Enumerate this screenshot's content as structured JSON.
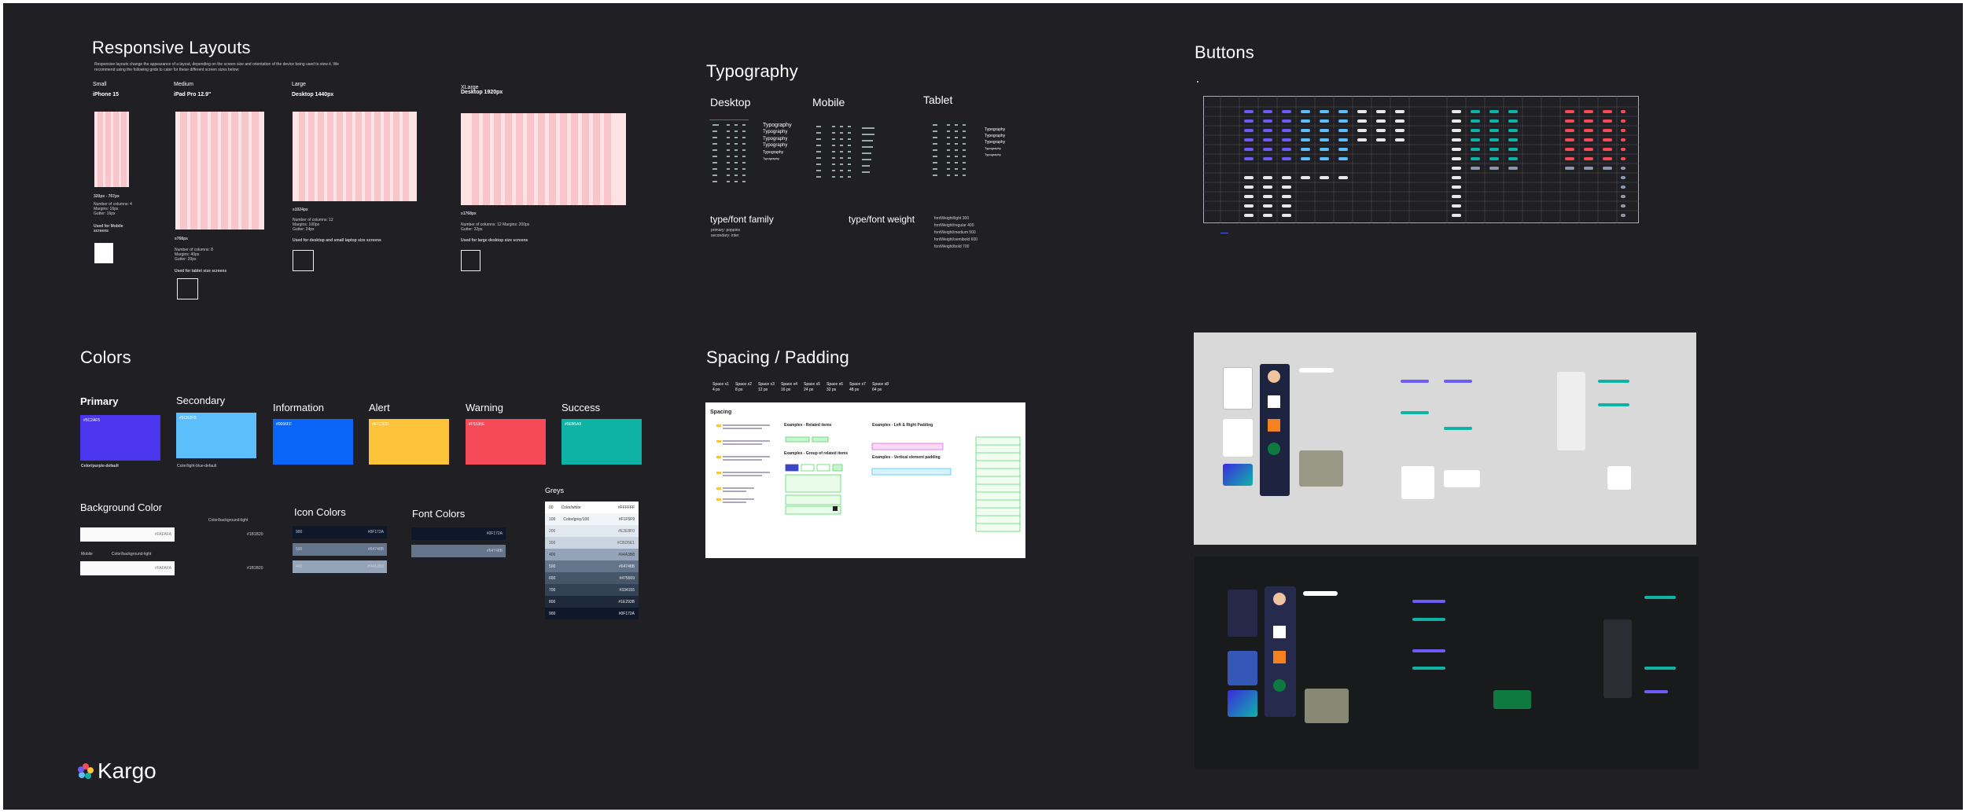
{
  "layouts": {
    "title": "Responsive Layouts",
    "desc1": "Responsive layouts change the appearance of a layout, depending on the screen size and orientation of the device being used to view it. We",
    "desc2": "recommend using the following grids to cater for these different screen sizes below:",
    "small": {
      "size": "Small",
      "device": "iPhone 15",
      "range": "320px - 767px",
      "info1": "Number of columns: 4",
      "info2": "Margins: 16px",
      "info3": "Gutter: 16px",
      "use": "Used for Mobile screens"
    },
    "medium": {
      "size": "Medium",
      "device": "iPad Pro 12.9\"",
      "range": "≥768px",
      "info1": "Number of columns: 8",
      "info2": "Margins: 40px",
      "info3": "Gutter: 20px",
      "use": "Used for tablet size screens"
    },
    "large": {
      "size": "Large",
      "device": "Desktop 1440px",
      "range": "≥1024px",
      "info1": "Number of columns: 12",
      "info2": "Margins: 100px",
      "info3": "Gutter: 24px",
      "use": "Used for desktop and small laptop size screens"
    },
    "xlarge": {
      "size": "XLarge",
      "device": "Desktop 1920px",
      "range": "≥1768px",
      "info1": "Number of columns: 12 Margins: 200px",
      "info2": "Gutter: 32px",
      "use": "Used for large desktop size screens"
    }
  },
  "typography": {
    "title": "Typography",
    "desktop": "Desktop",
    "mobile": "Mobile",
    "tablet": "Tablet",
    "family_title": "type/font family",
    "family_1": "primary: poppins",
    "family_2": "secondary: inter",
    "weight_title": "type/font weight",
    "weight_1": "fontWeight/light 300",
    "weight_2": "fontWeight/regular 400",
    "weight_3": "fontWeight/medium 500",
    "weight_4": "fontWeight/semibold 600",
    "weight_5": "fontWeight/bold 700",
    "sample": "Typography"
  },
  "buttons": {
    "title": "Buttons"
  },
  "colors": {
    "title": "Colors",
    "primary": {
      "label": "Primary",
      "hex": "#5C2AF5",
      "name": "Color/purple-default",
      "color": "#4b35ee"
    },
    "secondary": {
      "label": "Secondary",
      "hex": "#5CB2FB",
      "name": "Color/light-blue-default",
      "color": "#5cbefb"
    },
    "information": {
      "label": "Information",
      "hex": "#0066FF",
      "color": "#0a66f8"
    },
    "alert": {
      "label": "Alert",
      "hex": "#FFC53D",
      "color": "#fdc33a"
    },
    "warning": {
      "label": "Warning",
      "hex": "#F5535E",
      "color": "#f54a58"
    },
    "success": {
      "label": "Success",
      "hex": "#0EB5A9",
      "color": "#0fb3a6"
    }
  },
  "background": {
    "title": "Background Color",
    "light_label": "Color/background-light",
    "hex1": "#FAFAFA",
    "dark1": "#1B1B20",
    "mobile": "Mobile",
    "light_label2": "Color/background-light",
    "hex2": "#FAFAFA",
    "dark2": "#1B1B20"
  },
  "icon_colors": {
    "title": "Icon Colors",
    "rows": [
      {
        "code": "900",
        "hex": "#0F172A",
        "color": "#0f172a"
      },
      {
        "code": "500",
        "hex": "#64748B",
        "color": "#64748b"
      },
      {
        "code": "400",
        "hex": "#94A3B8",
        "color": "#94a3b8"
      }
    ]
  },
  "font_colors": {
    "title": "Font Colors",
    "rows": [
      {
        "code": "",
        "hex": "#0F172A",
        "color": "#0f172a"
      },
      {
        "code": "",
        "hex": "#64748B",
        "color": "#64748b"
      }
    ]
  },
  "greys": {
    "title": "Greys",
    "rows": [
      {
        "code": "00",
        "name": "Color/white",
        "hex": "#FFFFFF",
        "color": "#ffffff",
        "text": "#333"
      },
      {
        "code": "100",
        "name": "Color/grey/100",
        "hex": "#F1F5F9",
        "color": "#f1f5f9",
        "text": "#333"
      },
      {
        "code": "200",
        "name": "",
        "hex": "#E2E8F0",
        "color": "#e2e8f0",
        "text": "#555"
      },
      {
        "code": "300",
        "name": "",
        "hex": "#CBD5E1",
        "color": "#cbd5e1",
        "text": "#555"
      },
      {
        "code": "400",
        "name": "",
        "hex": "#94A3B8",
        "color": "#94a3b8",
        "text": "#333"
      },
      {
        "code": "500",
        "name": "",
        "hex": "#64748B",
        "color": "#64748b",
        "text": "#eee"
      },
      {
        "code": "600",
        "name": "",
        "hex": "#475569",
        "color": "#475569",
        "text": "#eee"
      },
      {
        "code": "700",
        "name": "",
        "hex": "#334155",
        "color": "#334155",
        "text": "#eee"
      },
      {
        "code": "800",
        "name": "",
        "hex": "#1E293B",
        "color": "#1e293b",
        "text": "#eee"
      },
      {
        "code": "900",
        "name": "",
        "hex": "#0F172A",
        "color": "#0f172a",
        "text": "#eee"
      }
    ]
  },
  "spacing": {
    "title": "Spacing / Padding",
    "chips": [
      {
        "label": "Space x1",
        "value": "4 px"
      },
      {
        "label": "Space x2",
        "value": "8 px"
      },
      {
        "label": "Space x3",
        "value": "12 px"
      },
      {
        "label": "Space x4",
        "value": "16 px"
      },
      {
        "label": "Space x5",
        "value": "24 px"
      },
      {
        "label": "Space x6",
        "value": "32 px"
      },
      {
        "label": "Space x7",
        "value": "48 px"
      },
      {
        "label": "Space x8",
        "value": "64 px"
      }
    ],
    "card_title": "Spacing",
    "ex1": "Examples - Related items",
    "ex2": "Examples - Left & Right Padding",
    "ex3": "Examples - Group of related items",
    "ex4": "Examples - Vertical element padding"
  },
  "brand": {
    "name": "Kargo"
  }
}
